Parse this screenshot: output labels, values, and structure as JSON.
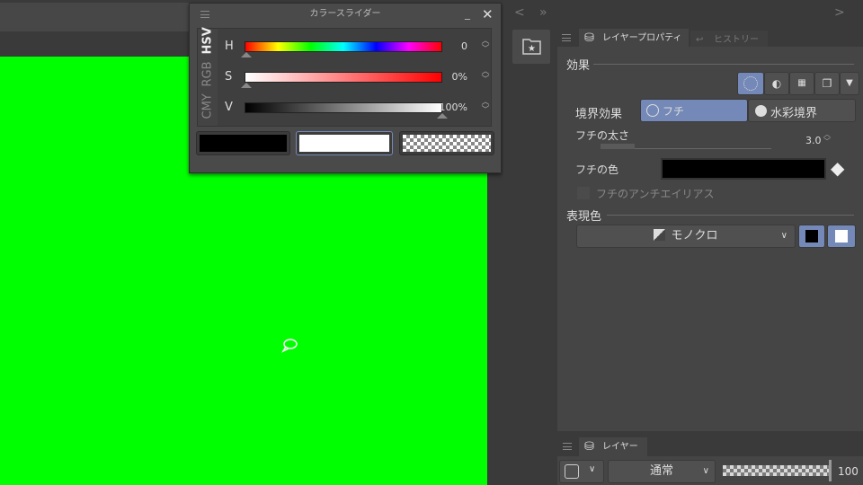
{
  "color_slider": {
    "title": "カラースライダー",
    "modes": [
      "HSV",
      "RGB",
      "CMY"
    ],
    "rows": [
      {
        "label": "H",
        "value": "0"
      },
      {
        "label": "S",
        "value": "0%"
      },
      {
        "label": "V",
        "value": "100%"
      }
    ],
    "main_color": "#000000",
    "sub_color": "#ffffff"
  },
  "nav": {
    "back": "<",
    "forward": "»",
    "next": ">"
  },
  "tabs": {
    "layer_property": "レイヤープロパティ",
    "history": "ヒストリー"
  },
  "effects": {
    "section": "効果",
    "border_effect_label": "境界効果",
    "edge_option": "フチ",
    "watercolor_option": "水彩境界",
    "edge_width_label": "フチの太さ",
    "edge_width_value": "3.0",
    "edge_color_label": "フチの色",
    "edge_color": "#000000",
    "antialias_label": "フチのアンチエイリアス"
  },
  "expression": {
    "section": "表現色",
    "mode": "モノクロ"
  },
  "layer_panel": {
    "tab": "レイヤー",
    "blend_mode": "通常",
    "opacity": "100"
  }
}
